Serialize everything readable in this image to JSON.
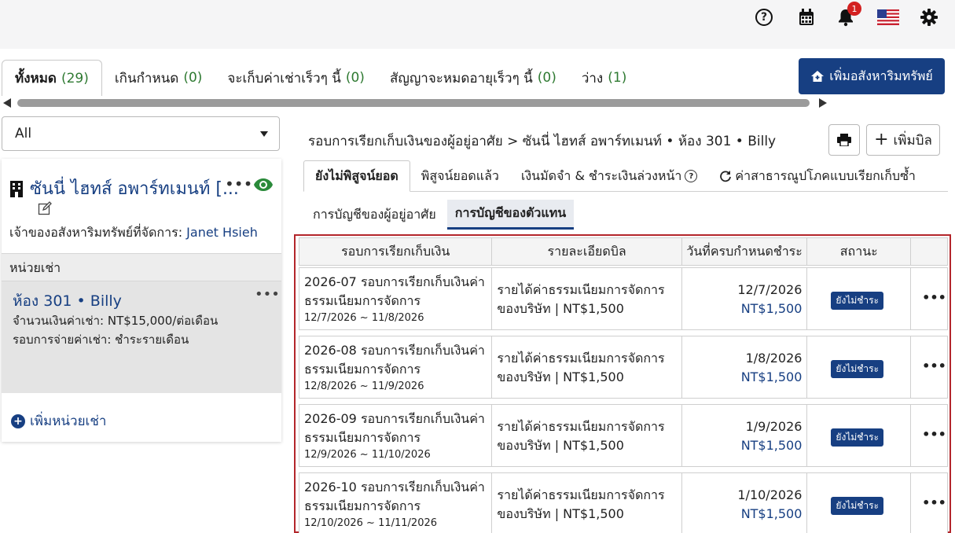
{
  "topbar": {
    "notification_count": "1",
    "help_glyph": "?",
    "icons": [
      "help-icon",
      "calendar-icon",
      "bell-icon",
      "us-flag-icon",
      "gear-icon"
    ]
  },
  "filter_tabs": [
    {
      "label": "ทั้งหมด",
      "count": "(29)"
    },
    {
      "label": "เกินกำหนด",
      "count": "(0)"
    },
    {
      "label": "จะเก็บค่าเช่าเร็วๆ นี้",
      "count": "(0)"
    },
    {
      "label": "สัญญาจะหมดอายุเร็วๆ นี้",
      "count": "(0)"
    },
    {
      "label": "ว่าง",
      "count": "(1)"
    }
  ],
  "add_property_label": "เพิ่มอสังหาริมทรัพย์",
  "filter_select": {
    "value": "All"
  },
  "property": {
    "title": "ซันนี่ ไฮทส์ อพาร์ทเมนท์ [...",
    "more_glyph": "•••",
    "owner_label": "เจ้าของอสังหาริมทรัพย์ที่จัดการ:",
    "owner_name": "Janet Hsieh"
  },
  "units": {
    "header": "หน่วยเช่า",
    "item": {
      "title": "ห้อง 301 • Billy",
      "more_glyph": "•••",
      "rent": "จำนวนเงินค่าเช่า: NT$15,000/ต่อเดือน",
      "cycle": "รอบการจ่ายค่าเช่า: ชำระรายเดือน"
    },
    "add_label": "เพิ่มหน่วยเช่า",
    "add_glyph": "+"
  },
  "breadcrumb": "รอบการเรียกเก็บเงินของผู้อยู่อาศัย > ซันนี่ ไฮทส์ อพาร์ทเมนท์ • ห้อง 301 • Billy",
  "add_bill_label": "เพิ่มบิล",
  "add_bill_glyph": "+",
  "status_tabs": [
    {
      "label": "ยังไม่พิสูจน์ยอด"
    },
    {
      "label": "พิสูจน์ยอดแล้ว"
    },
    {
      "label": "เงินมัดจำ & ชำระเงินล่วงหน้า",
      "help": "?"
    },
    {
      "label": "ค่าสาธารณูปโภคแบบเรียกเก็บซ้ำ"
    }
  ],
  "sub_tabs": [
    {
      "label": "การบัญชีของผู้อยู่อาศัย"
    },
    {
      "label": "การบัญชีของตัวแทน"
    }
  ],
  "table": {
    "headers": [
      "รอบการเรียกเก็บเงิน",
      "รายละเอียดบิล",
      "วันที่ครบกำหนดชำระ",
      "สถานะ"
    ],
    "more_glyph": "•••",
    "rows": [
      {
        "title_line1": "2026-07 รอบการเรียกเก็บเงินค่า",
        "title_line2": "ธรรมเนียมการจัดการ",
        "range": "12/7/2026 ~ 11/8/2026",
        "detail_line1": "รายได้ค่าธรรมเนียมการจัดการ",
        "detail_line2": "ของบริษัท | NT$1,500",
        "due_date": "12/7/2026",
        "amount": "NT$1,500",
        "status": "ยังไม่ชำระ"
      },
      {
        "title_line1": "2026-08 รอบการเรียกเก็บเงินค่า",
        "title_line2": "ธรรมเนียมการจัดการ",
        "range": "12/8/2026 ~ 11/9/2026",
        "detail_line1": "รายได้ค่าธรรมเนียมการจัดการ",
        "detail_line2": "ของบริษัท | NT$1,500",
        "due_date": "1/8/2026",
        "amount": "NT$1,500",
        "status": "ยังไม่ชำระ"
      },
      {
        "title_line1": "2026-09 รอบการเรียกเก็บเงินค่า",
        "title_line2": "ธรรมเนียมการจัดการ",
        "range": "12/9/2026 ~ 11/10/2026",
        "detail_line1": "รายได้ค่าธรรมเนียมการจัดการ",
        "detail_line2": "ของบริษัท | NT$1,500",
        "due_date": "1/9/2026",
        "amount": "NT$1,500",
        "status": "ยังไม่ชำระ"
      },
      {
        "title_line1": "2026-10 รอบการเรียกเก็บเงินค่า",
        "title_line2": "ธรรมเนียมการจัดการ",
        "range": "12/10/2026 ~ 11/11/2026",
        "detail_line1": "รายได้ค่าธรรมเนียมการจัดการ",
        "detail_line2": "ของบริษัท | NT$1,500",
        "due_date": "1/10/2026",
        "amount": "NT$1,500",
        "status": "ยังไม่ชำระ"
      }
    ]
  },
  "colors": {
    "brand": "#173f82",
    "count_green": "#2f7a32",
    "highlight_border": "#b3262b",
    "notification": "#d32020"
  }
}
